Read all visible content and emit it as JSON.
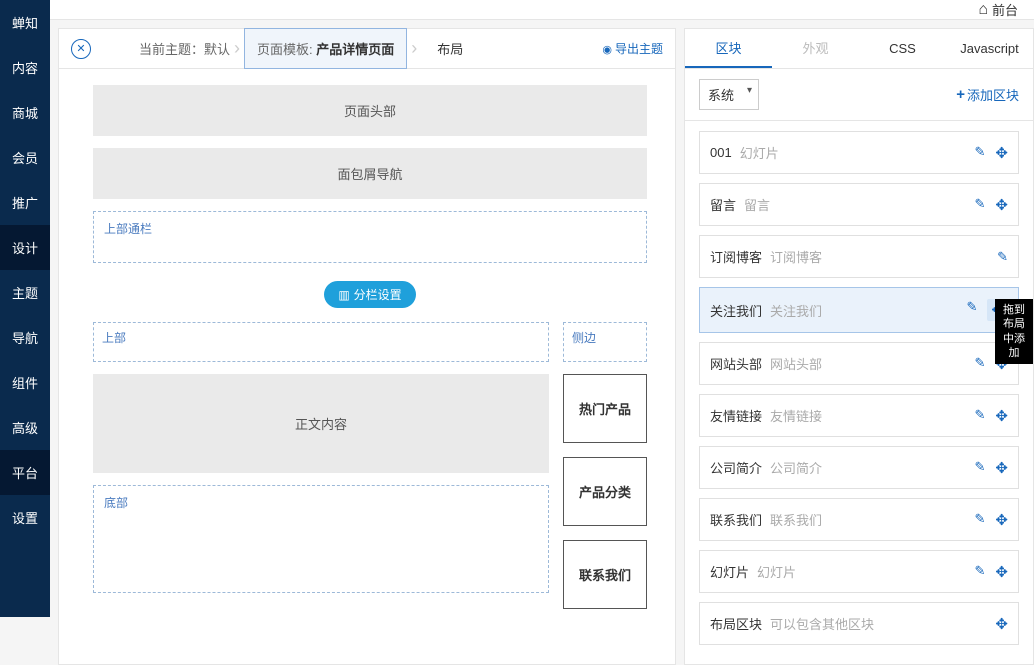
{
  "sidebar": {
    "items": [
      {
        "label": "蝉知"
      },
      {
        "label": "内容"
      },
      {
        "label": "商城"
      },
      {
        "label": "会员"
      },
      {
        "label": "推广"
      },
      {
        "label": "设计"
      },
      {
        "label": "主题"
      },
      {
        "label": "导航"
      },
      {
        "label": "组件"
      },
      {
        "label": "高级"
      },
      {
        "label": "平台"
      },
      {
        "label": "设置"
      }
    ]
  },
  "topbar": {
    "front": "前台"
  },
  "breadcrumb": {
    "currentThemeLabel": "当前主题：",
    "currentThemeValue": "默认",
    "templateLabel": "页面模板:",
    "templateValue": "产品详情页面",
    "layout": "布局",
    "export": "导出主题"
  },
  "canvas": {
    "header": "页面头部",
    "breadcrumbNav": "面包屑导航",
    "topBanner": "上部通栏",
    "columnSetting": "分栏设置",
    "top": "上部",
    "side": "侧边",
    "mainContent": "正文内容",
    "bottom": "底部",
    "sideBlocks": [
      "热门产品",
      "产品分类",
      "联系我们"
    ]
  },
  "rightPanel": {
    "tabs": [
      {
        "label": "区块",
        "active": true
      },
      {
        "label": "外观",
        "disabled": true
      },
      {
        "label": "CSS"
      },
      {
        "label": "Javascript"
      }
    ],
    "selectValue": "系统",
    "addBlock": "添加区块",
    "tooltip": "拖到布局中添加",
    "items": [
      {
        "title": "001",
        "sub": "幻灯片"
      },
      {
        "title": "留言",
        "sub": "留言"
      },
      {
        "title": "订阅博客",
        "sub": "订阅博客",
        "noMove": true
      },
      {
        "title": "关注我们",
        "sub": "关注我们",
        "highlight": true
      },
      {
        "title": "网站头部",
        "sub": "网站头部"
      },
      {
        "title": "友情链接",
        "sub": "友情链接"
      },
      {
        "title": "公司简介",
        "sub": "公司简介"
      },
      {
        "title": "联系我们",
        "sub": "联系我们"
      },
      {
        "title": "幻灯片",
        "sub": "幻灯片"
      },
      {
        "title": "布局区块",
        "sub": "可以包含其他区块",
        "noEdit": true
      }
    ]
  }
}
